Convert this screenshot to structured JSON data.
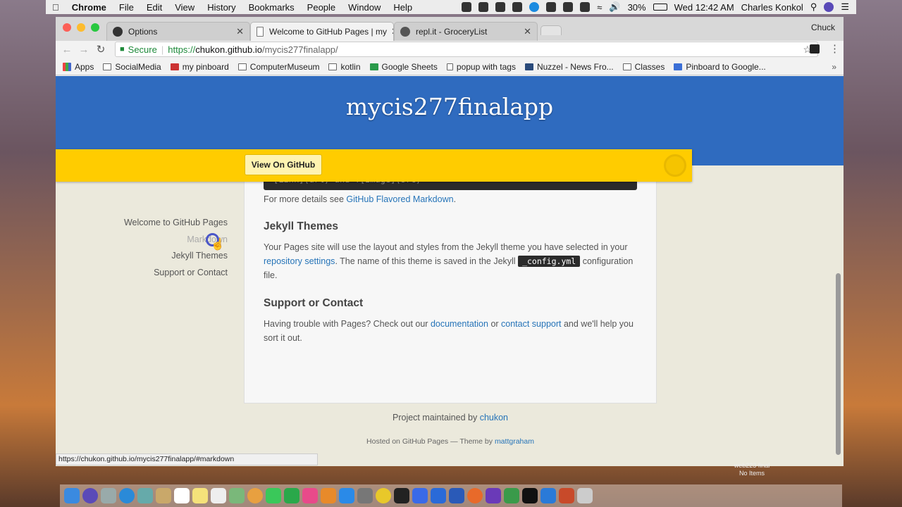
{
  "menubar": {
    "app_name": "Chrome",
    "menus": [
      "File",
      "Edit",
      "View",
      "History",
      "Bookmarks",
      "People",
      "Window",
      "Help"
    ],
    "battery": "30%",
    "clock": "Wed 12:42 AM",
    "user": "Charles Konkol"
  },
  "browser": {
    "profile": "Chuck",
    "tabs": [
      {
        "label": "Options",
        "icon": "github-icon"
      },
      {
        "label": "Welcome to GitHub Pages | my",
        "icon": "page-icon"
      },
      {
        "label": "repl.it - GroceryList",
        "icon": "replit-icon"
      }
    ],
    "address": {
      "secure_label": "Secure",
      "scheme": "https://",
      "host": "chukon.github.io",
      "path": "/mycis277finalapp/"
    },
    "bookmarks": [
      "Apps",
      "SocialMedia",
      "my pinboard",
      "ComputerMuseum",
      "kotlin",
      "Google Sheets",
      "popup with tags",
      "Nuzzel - News Fro...",
      "Classes",
      "Pinboard to Google..."
    ],
    "status_url": "https://chukon.github.io/mycis277finalapp/#markdown"
  },
  "site": {
    "title": "mycis277finalapp",
    "view_on_github": "View On GitHub",
    "code_snippet": "[Link](url) and ![Image](src)",
    "more_details_prefix": "For more details see ",
    "more_details_link": "GitHub Flavored Markdown",
    "more_details_suffix": ".",
    "jekyll_heading": "Jekyll Themes",
    "jekyll_text_1": "Your Pages site will use the layout and styles from the Jekyll theme you have selected in your ",
    "jekyll_link": "repository settings",
    "jekyll_text_2": ". The name of this theme is saved in the Jekyll ",
    "jekyll_code": "_config.yml",
    "jekyll_text_3": " configuration file.",
    "support_heading": "Support or Contact",
    "support_text_1": "Having trouble with Pages? Check out our ",
    "support_link_1": "documentation",
    "support_text_2": " or ",
    "support_link_2": "contact support",
    "support_text_3": " and we'll help you sort it out.",
    "sidebar": [
      "Welcome to GitHub Pages",
      "Markdown",
      "Jekyll Themes",
      "Support or Contact"
    ],
    "footer_maintained_prefix": "Project maintained by ",
    "footer_maintained_link": "chukon",
    "footer_hosted_prefix": "Hosted on GitHub Pages — Theme by ",
    "footer_hosted_link": "mattgraham"
  },
  "desktop": {
    "folder_label": "web223 final",
    "folder_sublabel": "No Items"
  },
  "colors": {
    "header_blue": "#2f6bbf",
    "ribbon_yellow": "#ffcc00",
    "link_blue": "#2674b8",
    "page_bg": "#ebe9dc"
  }
}
